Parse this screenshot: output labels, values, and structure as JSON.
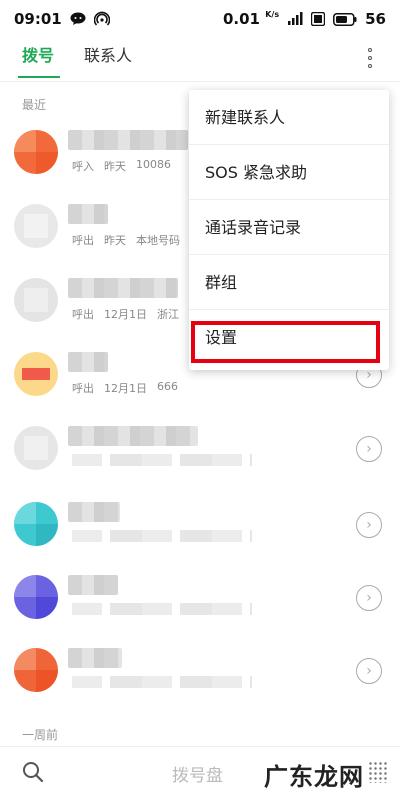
{
  "status_bar": {
    "time": "09:01",
    "speed_value": "0.01",
    "speed_unit": "K/s",
    "battery": "56"
  },
  "tabs": {
    "dial": "拨号",
    "contacts": "联系人"
  },
  "sections": {
    "recent": "最近",
    "week_ago": "一周前"
  },
  "calls": [
    {
      "type": "呼入",
      "date": "昨天",
      "info": "10086"
    },
    {
      "type": "呼出",
      "date": "昨天",
      "info": "本地号码"
    },
    {
      "type": "呼出",
      "date": "12月1日",
      "info": "浙江"
    },
    {
      "type": "呼出",
      "date": "12月1日",
      "info": "666"
    }
  ],
  "menu": {
    "items": [
      "新建联系人",
      "SOS 紧急求助",
      "通话录音记录",
      "群组",
      "设置"
    ]
  },
  "bottom": {
    "dial_pad": "拨号盘",
    "watermark": "广东龙网"
  },
  "colors": {
    "accent": "#1fa855",
    "highlight": "#e60012"
  },
  "icons": {
    "more": "more-vertical-icon",
    "search": "search-icon",
    "arrow": "chevron-right-icon"
  }
}
